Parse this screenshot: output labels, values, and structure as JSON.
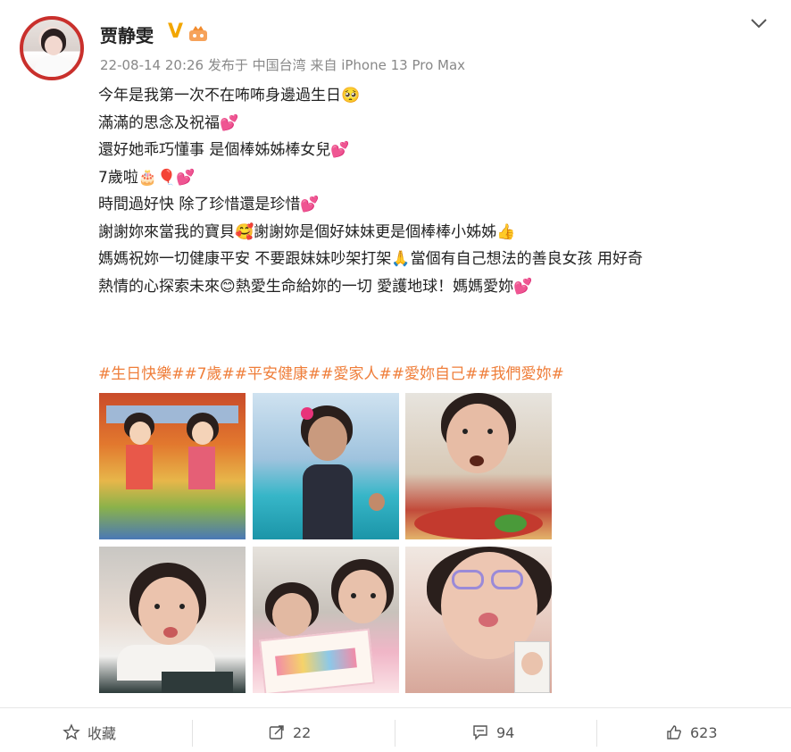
{
  "user": {
    "name": "贾静雯",
    "badge": "V",
    "avatar_icon": "avatar-photo"
  },
  "meta": {
    "time": "22-08-14 20:26",
    "location": "发布于 中国台湾",
    "device": "来自 iPhone 13 Pro Max"
  },
  "post": {
    "lines": [
      "今年是我第一次不在咘咘身邊過生日🥺",
      "滿滿的思念及祝福💕",
      "還好她乖巧懂事 是個棒姊姊棒女兒💕",
      "7歲啦🎂🎈💕",
      "時間過好快 除了珍惜還是珍惜💕",
      "謝謝妳來當我的寶貝🥰謝謝妳是個好妹妹更是個棒棒小姊姊👍",
      "媽媽祝妳一切健康平安 不要跟妹妹吵架打架🙏當個有自己想法的善良女孩 用好奇",
      "熱情的心探索未來😊熱愛生命給妳的一切 愛護地球！媽媽愛妳💕"
    ],
    "tags": "#生日快樂##7歲##平安健康##愛家人##愛妳自己##我們愛妳#"
  },
  "images": [
    {
      "name": "photo-drawing-two-girls"
    },
    {
      "name": "photo-girl-pool"
    },
    {
      "name": "photo-girl-eating"
    },
    {
      "name": "photo-girl-pout"
    },
    {
      "name": "photo-girls-card"
    },
    {
      "name": "photo-girl-glasses-videocall"
    }
  ],
  "actions": {
    "favorite_label": "收藏",
    "repost_count": "22",
    "comment_count": "94",
    "like_count": "623"
  },
  "colors": {
    "tag": "#ef7e3a",
    "badge": "#f2a600",
    "avatar_ring": "#c9302c"
  }
}
